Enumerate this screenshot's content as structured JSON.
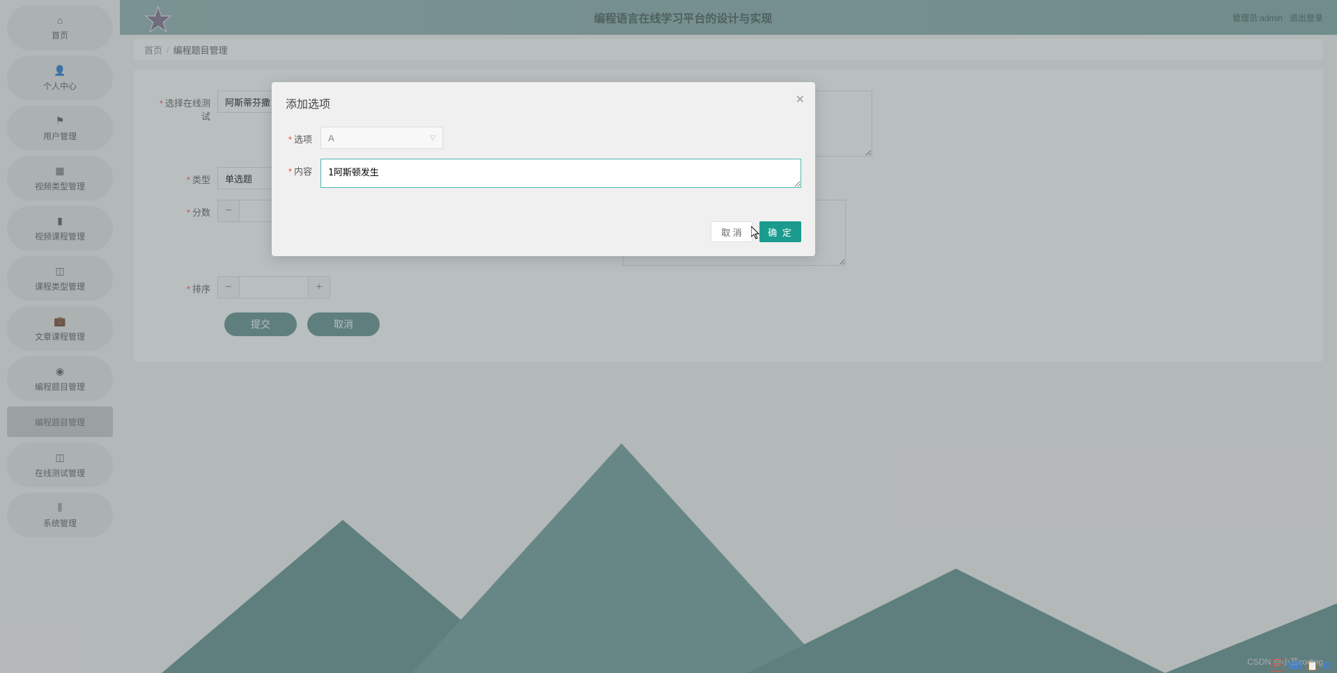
{
  "header": {
    "title": "编程语言在线学习平台的设计与实现",
    "user_role": "管理员:admin",
    "logout": "退出登录"
  },
  "breadcrumb": {
    "home": "首页",
    "current": "编程题目管理"
  },
  "sidebar": {
    "items": [
      {
        "icon": "home",
        "label": "首页"
      },
      {
        "icon": "person",
        "label": "个人中心"
      },
      {
        "icon": "flag",
        "label": "用户管理"
      },
      {
        "icon": "grid",
        "label": "视频类型管理"
      },
      {
        "icon": "book",
        "label": "视频课程管理"
      },
      {
        "icon": "apps",
        "label": "课程类型管理"
      },
      {
        "icon": "case",
        "label": "文章课程管理"
      },
      {
        "icon": "check",
        "label": "编程题目管理"
      },
      {
        "icon": "",
        "label": "编程题目管理"
      },
      {
        "icon": "apps2",
        "label": "在线测试管理"
      },
      {
        "icon": "chart",
        "label": "系统管理"
      }
    ]
  },
  "form": {
    "select_test_label": "选择在线测试",
    "select_test_value": "阿斯蒂芬撒",
    "type_label": "类型",
    "type_value": "单选题",
    "score_label": "分数",
    "sort_label": "排序",
    "submit": "提交",
    "cancel": "取消"
  },
  "modal": {
    "title": "添加选项",
    "option_label": "选项",
    "option_value": "A",
    "content_label": "内容",
    "content_value": "1阿斯顿发生",
    "cancel": "取 消",
    "ok": "确 定"
  },
  "watermark": "CSDN @小芸coding",
  "taskbar": {
    "ime": "中"
  }
}
